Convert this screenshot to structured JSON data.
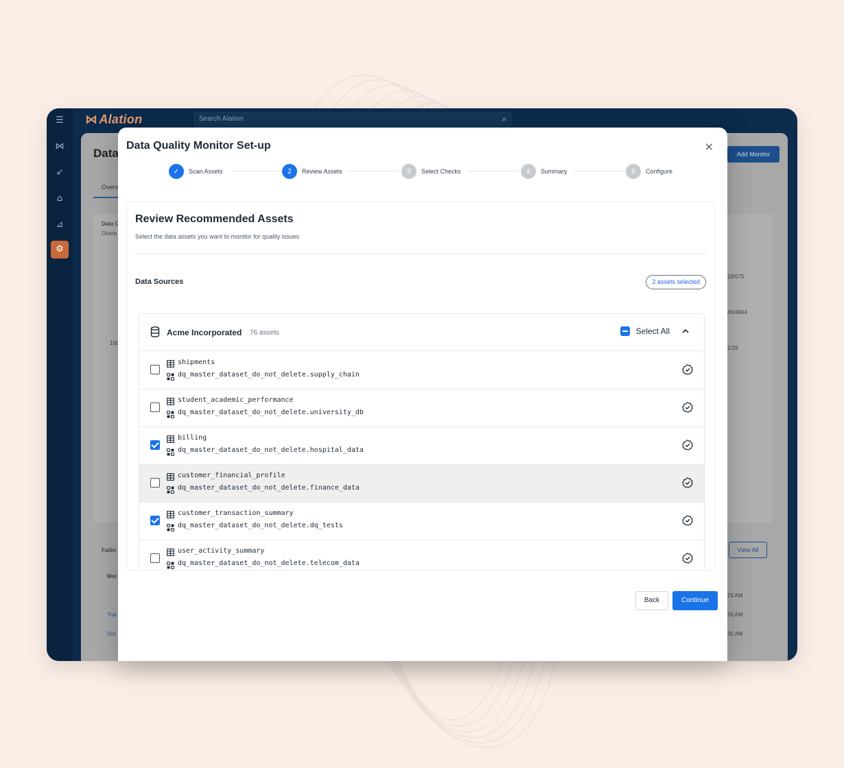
{
  "app": {
    "logo_text": "Alation",
    "search_placeholder": "Search Alation",
    "page_title": "Data",
    "page_tab": "Overv",
    "add_monitor_label": "Add Monitor",
    "view_all_label": "View All",
    "bg_fragments": {
      "card_title": "Data C",
      "card_sub": "Overa",
      "stat1": "18/575",
      "stat2": "46/4844",
      "stat3": "1/28",
      "axis_100": "100",
      "failing": "Failin",
      "mon": "Mor",
      "time1": "25 AM",
      "time2": "26 AM",
      "time3": "35 AM",
      "link1": "Trai",
      "link2": "Onl"
    },
    "rail_icons": [
      "menu-icon",
      "alation-mark-icon",
      "rocket-icon",
      "bank-icon",
      "chart-icon",
      "settings-icon"
    ]
  },
  "modal": {
    "title": "Data Quality Monitor Set-up",
    "close_label": "×",
    "steps": [
      {
        "num": "✓",
        "label": "Scan Assets",
        "state": "done"
      },
      {
        "num": "2",
        "label": "Review Assets",
        "state": "current"
      },
      {
        "num": "3",
        "label": "Select Checks",
        "state": "pending"
      },
      {
        "num": "4",
        "label": "Summary",
        "state": "pending"
      },
      {
        "num": "5",
        "label": "Configure",
        "state": "pending"
      }
    ],
    "section": {
      "title": "Review Recommended Assets",
      "subtitle": "Select the data assets you want to monitor for quality issues",
      "data_sources_label": "Data Sources",
      "selected_badge": "2 assets selected"
    },
    "group": {
      "name": "Acme Incorporated",
      "count": "76 assets",
      "select_all_label": "Select All",
      "rows": [
        {
          "name": "shipments",
          "path": "dq_master_dataset_do_not_delete.supply_chain",
          "checked": false
        },
        {
          "name": "student_academic_performance",
          "path": "dq_master_dataset_do_not_delete.university_db",
          "checked": false
        },
        {
          "name": "billing",
          "path": "dq_master_dataset_do_not_delete.hospital_data",
          "checked": true
        },
        {
          "name": "customer_financial_profile",
          "path": "dq_master_dataset_do_not_delete.finance_data",
          "checked": false
        },
        {
          "name": "customer_transaction_summary",
          "path": "dq_master_dataset_do_not_delete.dq_tests",
          "checked": true
        },
        {
          "name": "user_activity_summary",
          "path": "dq_master_dataset_do_not_delete.telecom_data",
          "checked": false
        }
      ]
    },
    "back_label": "Back",
    "continue_label": "Continue"
  },
  "colors": {
    "accent": "#1a73e8",
    "app_navy": "#0c2b4d",
    "logo_orange": "#e59a6a",
    "page_bg": "#fbeee6"
  }
}
